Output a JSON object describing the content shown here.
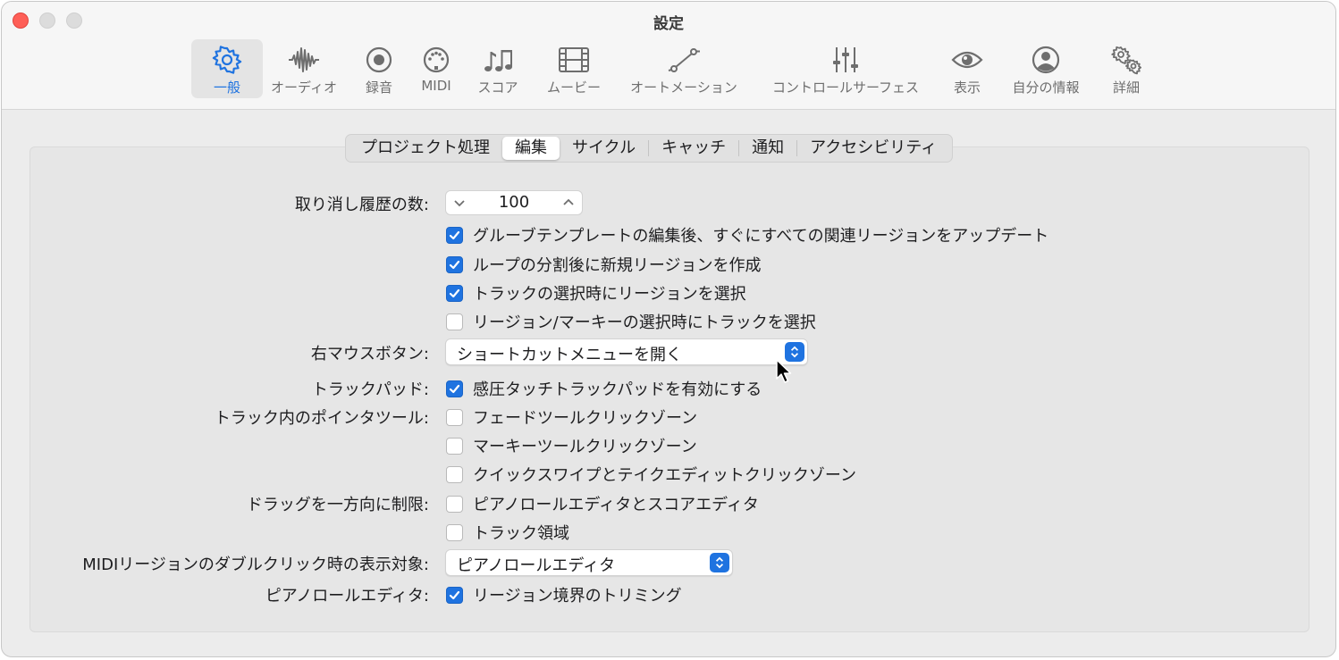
{
  "window": {
    "title": "設定"
  },
  "toolbar": [
    {
      "label": "一般",
      "icon": "gear-icon",
      "selected": true
    },
    {
      "label": "オーディオ",
      "icon": "waveform-icon"
    },
    {
      "label": "録音",
      "icon": "record-icon"
    },
    {
      "label": "MIDI",
      "icon": "midi-port-icon"
    },
    {
      "label": "スコア",
      "icon": "music-notes-icon"
    },
    {
      "label": "ムービー",
      "icon": "film-icon"
    },
    {
      "label": "オートメーション",
      "icon": "automation-curve-icon"
    },
    {
      "label": "コントロールサーフェス",
      "icon": "sliders-icon"
    },
    {
      "label": "表示",
      "icon": "eye-icon"
    },
    {
      "label": "自分の情報",
      "icon": "person-icon"
    },
    {
      "label": "詳細",
      "icon": "gears-icon"
    }
  ],
  "tabs": [
    {
      "label": "プロジェクト処理"
    },
    {
      "label": "編集",
      "active": true
    },
    {
      "label": "サイクル"
    },
    {
      "label": "キャッチ"
    },
    {
      "label": "通知"
    },
    {
      "label": "アクセシビリティ"
    }
  ],
  "settings": {
    "undo_label": "取り消し履歴の数:",
    "undo_value": "100",
    "cb_groove": {
      "label": "グルーブテンプレートの編集後、すぐにすべての関連リージョンをアップデート",
      "checked": true
    },
    "cb_loop": {
      "label": "ループの分割後に新規リージョンを作成",
      "checked": true
    },
    "cb_track_select": {
      "label": "トラックの選択時にリージョンを選択",
      "checked": true
    },
    "cb_region_marquee": {
      "label": "リージョン/マーキーの選択時にトラックを選択",
      "checked": false
    },
    "right_mouse_label": "右マウスボタン:",
    "right_mouse_value": "ショートカットメニューを開く",
    "trackpad_label": "トラックパッド:",
    "cb_force_touch": {
      "label": "感圧タッチトラックパッドを有効にする",
      "checked": true
    },
    "pointer_label": "トラック内のポインタツール:",
    "cb_fade": {
      "label": "フェードツールクリックゾーン",
      "checked": false
    },
    "cb_marquee": {
      "label": "マーキーツールクリックゾーン",
      "checked": false
    },
    "cb_quickswipe": {
      "label": "クイックスワイプとテイクエディットクリックゾーン",
      "checked": false
    },
    "drag_label": "ドラッグを一方向に制限:",
    "cb_piano_score": {
      "label": "ピアノロールエディタとスコアエディタ",
      "checked": false
    },
    "cb_track_area": {
      "label": "トラック領域",
      "checked": false
    },
    "midi_dbl_label": "MIDIリージョンのダブルクリック時の表示対象:",
    "midi_dbl_value": "ピアノロールエディタ",
    "piano_label": "ピアノロールエディタ:",
    "cb_region_trim": {
      "label": "リージョン境界のトリミング",
      "checked": true
    }
  },
  "colors": {
    "accent": "#1f73e0",
    "close": "#fe5f57"
  }
}
